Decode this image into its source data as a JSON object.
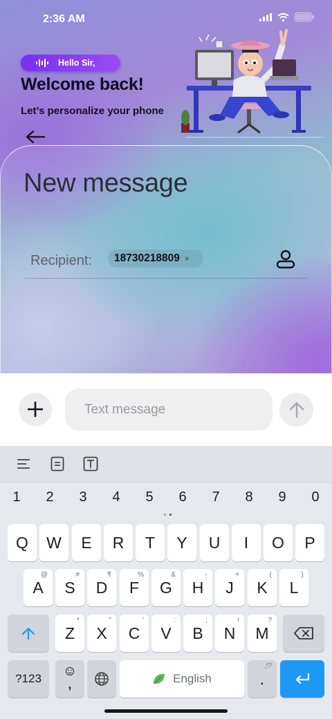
{
  "status_bar": {
    "time": "2:36 AM"
  },
  "header": {
    "greeting": "Hello Sir,",
    "welcome": "Welcome back!",
    "subtitle": "Let’s personalize your phone"
  },
  "compose": {
    "title": "New message",
    "recipient_label": "Recipient:",
    "recipient_chip": "18730218809",
    "chip_remove": "×",
    "message_placeholder": "Text message"
  },
  "keyboard": {
    "numbers": [
      "1",
      "2",
      "3",
      "4",
      "5",
      "6",
      "7",
      "8",
      "9",
      "0"
    ],
    "row1": [
      "Q",
      "W",
      "E",
      "R",
      "T",
      "Y",
      "U",
      "I",
      "O",
      "P"
    ],
    "row2": [
      "A",
      "S",
      "D",
      "F",
      "G",
      "H",
      "J",
      "K",
      "L"
    ],
    "row2_sup": [
      "@",
      "#",
      "₹",
      "%",
      "&",
      "-",
      "+",
      "(",
      ")"
    ],
    "row3": [
      "Z",
      "X",
      "C",
      "V",
      "B",
      "N",
      "M"
    ],
    "row3_sup": [
      "*",
      "\"",
      "'",
      ":",
      ";",
      "!",
      "?"
    ],
    "symbols_label": "?123",
    "comma_label": ",",
    "space_label": "English",
    "period_label": ".",
    "period_sup": ",!?"
  },
  "colors": {
    "accent": "#1e98f5",
    "pill": "#7b2ff0"
  }
}
